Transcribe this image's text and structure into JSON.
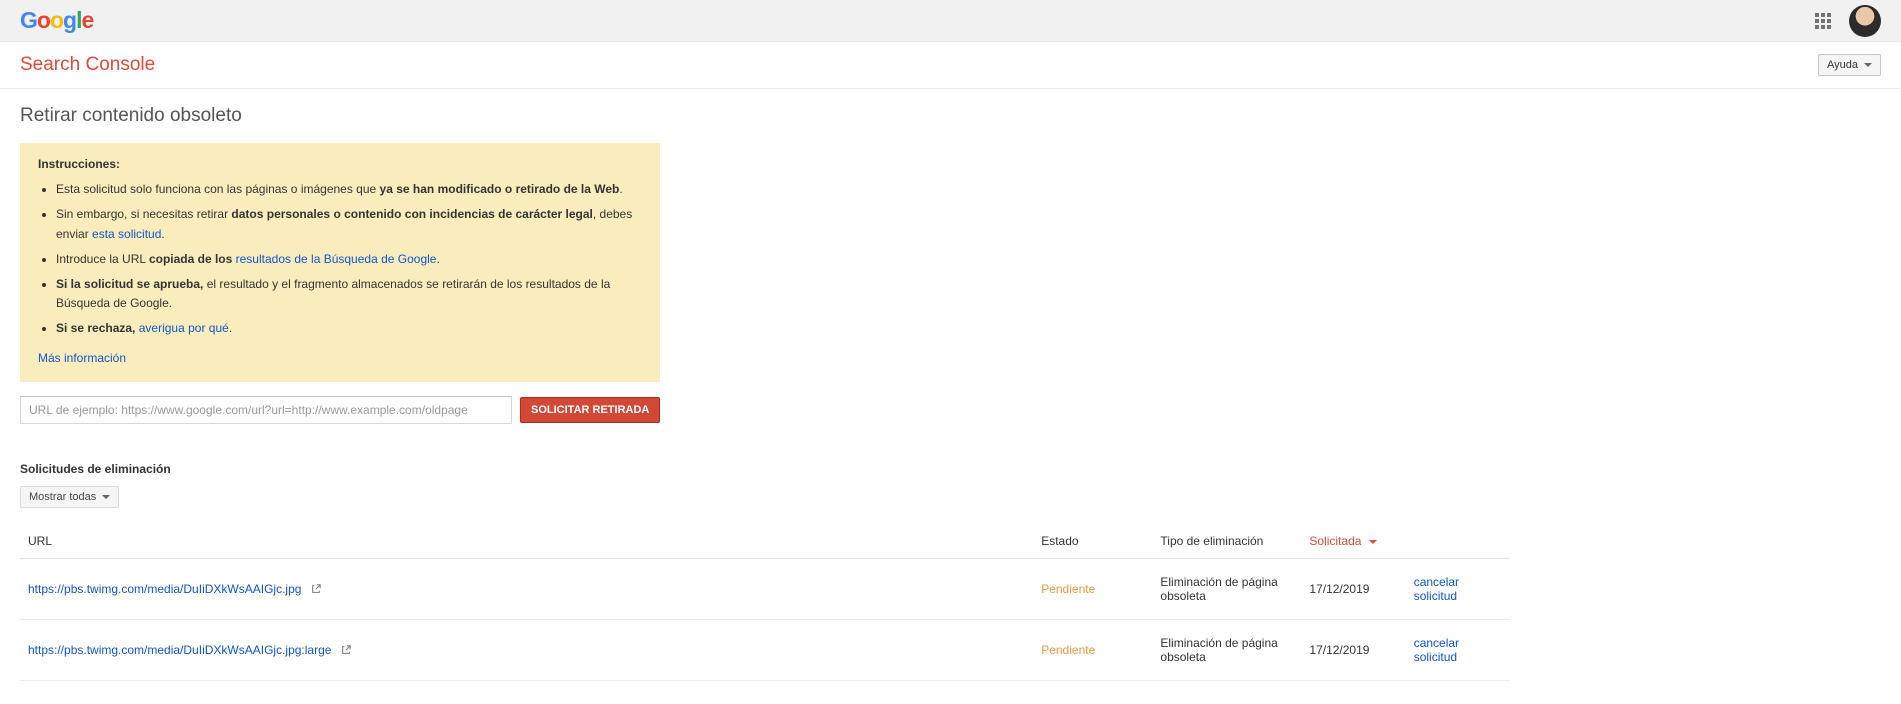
{
  "header": {
    "product_name": "Search Console",
    "help_label": "Ayuda"
  },
  "page": {
    "title": "Retirar contenido obsoleto"
  },
  "instructions": {
    "heading": "Instrucciones:",
    "item1_pre": "Esta solicitud solo funciona con las páginas o imágenes que ",
    "item1_bold": "ya se han modificado o retirado de la Web",
    "item2_pre": "Sin embargo, si necesitas retirar ",
    "item2_bold": "datos personales o contenido con incidencias de carácter legal",
    "item2_mid": ", debes enviar ",
    "item2_link": "esta solicitud",
    "item3_pre": "Introduce la URL ",
    "item3_bold": "copiada de los ",
    "item3_link": "resultados de la Búsqueda de Google",
    "item4_bold": "Si la solicitud se aprueba,",
    "item4_post": " el resultado y el fragmento almacenados se retirarán de los resultados de la Búsqueda de Google.",
    "item5_bold": "Si se rechaza,",
    "item5_link": "averigua por qué",
    "more_info": "Más información"
  },
  "form": {
    "url_placeholder": "URL de ejemplo: https://www.google.com/url?url=http://www.example.com/oldpage",
    "submit_label": "SOLICITAR RETIRADA"
  },
  "requests_section": {
    "title": "Solicitudes de eliminación",
    "filter_label": "Mostrar todas",
    "columns": {
      "url": "URL",
      "status": "Estado",
      "type": "Tipo de eliminación",
      "requested": "Solicitada"
    },
    "rows": [
      {
        "url": "https://pbs.twimg.com/media/DuIiDXkWsAAIGjc.jpg",
        "status": "Pendiente",
        "type": "Eliminación de página obsoleta",
        "date": "17/12/2019",
        "action": "cancelar solicitud"
      },
      {
        "url": "https://pbs.twimg.com/media/DuIiDXkWsAAIGjc.jpg:large",
        "status": "Pendiente",
        "type": "Eliminación de página obsoleta",
        "date": "17/12/2019",
        "action": "cancelar solicitud"
      }
    ]
  }
}
